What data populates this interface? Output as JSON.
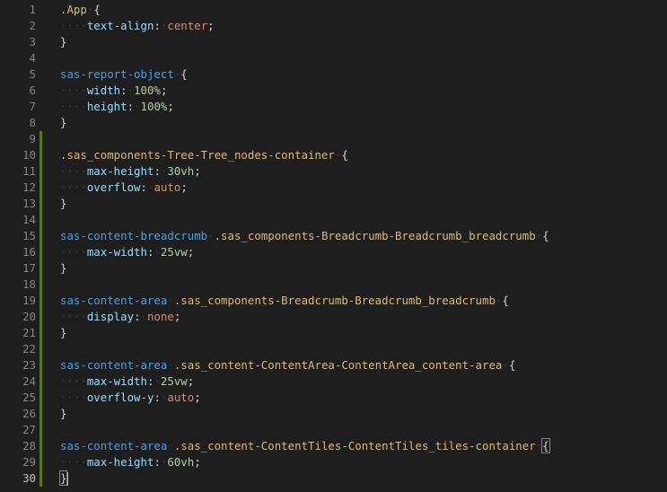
{
  "editor": {
    "language": "css",
    "cursor_line": 30,
    "lines": [
      {
        "n": "1",
        "tokens": [
          {
            "t": "sel",
            "v": ".App"
          },
          {
            "t": "sp"
          },
          {
            "t": "punc",
            "v": "{"
          }
        ]
      },
      {
        "n": "2",
        "tokens": [
          {
            "t": "ind"
          },
          {
            "t": "prop",
            "v": "text-align"
          },
          {
            "t": "punc",
            "v": ":"
          },
          {
            "t": "sp"
          },
          {
            "t": "val",
            "v": "center"
          },
          {
            "t": "punc",
            "v": ";"
          }
        ]
      },
      {
        "n": "3",
        "tokens": [
          {
            "t": "punc",
            "v": "}"
          }
        ]
      },
      {
        "n": "4",
        "tokens": []
      },
      {
        "n": "5",
        "tokens": [
          {
            "t": "tag",
            "v": "sas-report-object"
          },
          {
            "t": "sp"
          },
          {
            "t": "punc",
            "v": "{"
          }
        ]
      },
      {
        "n": "6",
        "tokens": [
          {
            "t": "ind"
          },
          {
            "t": "prop",
            "v": "width"
          },
          {
            "t": "punc",
            "v": ":"
          },
          {
            "t": "sp"
          },
          {
            "t": "num",
            "v": "100%"
          },
          {
            "t": "punc",
            "v": ";"
          }
        ]
      },
      {
        "n": "7",
        "tokens": [
          {
            "t": "ind"
          },
          {
            "t": "prop",
            "v": "height"
          },
          {
            "t": "punc",
            "v": ":"
          },
          {
            "t": "sp"
          },
          {
            "t": "num",
            "v": "100%"
          },
          {
            "t": "punc",
            "v": ";"
          }
        ]
      },
      {
        "n": "8",
        "tokens": [
          {
            "t": "punc",
            "v": "}"
          }
        ]
      },
      {
        "n": "9",
        "tokens": []
      },
      {
        "n": "10",
        "tokens": [
          {
            "t": "sel",
            "v": ".sas_components-Tree-Tree_nodes-container"
          },
          {
            "t": "sp"
          },
          {
            "t": "punc",
            "v": "{"
          }
        ]
      },
      {
        "n": "11",
        "tokens": [
          {
            "t": "ind"
          },
          {
            "t": "prop",
            "v": "max-height"
          },
          {
            "t": "punc",
            "v": ":"
          },
          {
            "t": "sp"
          },
          {
            "t": "num",
            "v": "30vh"
          },
          {
            "t": "punc",
            "v": ";"
          }
        ]
      },
      {
        "n": "12",
        "tokens": [
          {
            "t": "ind"
          },
          {
            "t": "prop",
            "v": "overflow"
          },
          {
            "t": "punc",
            "v": ":"
          },
          {
            "t": "sp"
          },
          {
            "t": "val",
            "v": "auto"
          },
          {
            "t": "punc",
            "v": ";"
          }
        ]
      },
      {
        "n": "13",
        "tokens": [
          {
            "t": "punc",
            "v": "}"
          }
        ]
      },
      {
        "n": "14",
        "tokens": []
      },
      {
        "n": "15",
        "tokens": [
          {
            "t": "tag",
            "v": "sas-content-breadcrumb"
          },
          {
            "t": "sp"
          },
          {
            "t": "sel",
            "v": ".sas_components-Breadcrumb-Breadcrumb_breadcrumb"
          },
          {
            "t": "sp"
          },
          {
            "t": "punc",
            "v": "{"
          }
        ]
      },
      {
        "n": "16",
        "tokens": [
          {
            "t": "ind"
          },
          {
            "t": "prop",
            "v": "max-width"
          },
          {
            "t": "punc",
            "v": ":"
          },
          {
            "t": "sp"
          },
          {
            "t": "num",
            "v": "25vw"
          },
          {
            "t": "punc",
            "v": ";"
          }
        ]
      },
      {
        "n": "17",
        "tokens": [
          {
            "t": "punc",
            "v": "}"
          }
        ]
      },
      {
        "n": "18",
        "tokens": []
      },
      {
        "n": "19",
        "tokens": [
          {
            "t": "tag",
            "v": "sas-content-area"
          },
          {
            "t": "sp"
          },
          {
            "t": "sel",
            "v": ".sas_components-Breadcrumb-Breadcrumb_breadcrumb"
          },
          {
            "t": "sp"
          },
          {
            "t": "punc",
            "v": "{"
          }
        ]
      },
      {
        "n": "20",
        "tokens": [
          {
            "t": "ind"
          },
          {
            "t": "prop",
            "v": "display"
          },
          {
            "t": "punc",
            "v": ":"
          },
          {
            "t": "sp"
          },
          {
            "t": "val",
            "v": "none"
          },
          {
            "t": "punc",
            "v": ";"
          }
        ]
      },
      {
        "n": "21",
        "tokens": [
          {
            "t": "punc",
            "v": "}"
          }
        ]
      },
      {
        "n": "22",
        "tokens": []
      },
      {
        "n": "23",
        "tokens": [
          {
            "t": "tag",
            "v": "sas-content-area"
          },
          {
            "t": "sp"
          },
          {
            "t": "sel",
            "v": ".sas_content-ContentArea-ContentArea_content-area"
          },
          {
            "t": "sp"
          },
          {
            "t": "punc",
            "v": "{"
          }
        ]
      },
      {
        "n": "24",
        "tokens": [
          {
            "t": "ind"
          },
          {
            "t": "prop",
            "v": "max-width"
          },
          {
            "t": "punc",
            "v": ":"
          },
          {
            "t": "sp"
          },
          {
            "t": "num",
            "v": "25vw"
          },
          {
            "t": "punc",
            "v": ";"
          }
        ]
      },
      {
        "n": "25",
        "tokens": [
          {
            "t": "ind"
          },
          {
            "t": "prop",
            "v": "overflow-y"
          },
          {
            "t": "punc",
            "v": ":"
          },
          {
            "t": "sp"
          },
          {
            "t": "val",
            "v": "auto"
          },
          {
            "t": "punc",
            "v": ";"
          }
        ]
      },
      {
        "n": "26",
        "tokens": [
          {
            "t": "punc",
            "v": "}"
          }
        ]
      },
      {
        "n": "27",
        "tokens": []
      },
      {
        "n": "28",
        "tokens": [
          {
            "t": "tag",
            "v": "sas-content-area"
          },
          {
            "t": "sp"
          },
          {
            "t": "sel",
            "v": ".sas_content-ContentTiles-ContentTiles_tiles-container"
          },
          {
            "t": "sp"
          },
          {
            "t": "bracket",
            "v": "{"
          }
        ]
      },
      {
        "n": "29",
        "tokens": [
          {
            "t": "ind"
          },
          {
            "t": "prop",
            "v": "max-height"
          },
          {
            "t": "punc",
            "v": ":"
          },
          {
            "t": "sp"
          },
          {
            "t": "num",
            "v": "60vh"
          },
          {
            "t": "punc",
            "v": ";"
          }
        ]
      },
      {
        "n": "30",
        "tokens": [
          {
            "t": "bracket",
            "v": "}"
          },
          {
            "t": "cursor"
          }
        ]
      }
    ],
    "modified_lines": [
      "9",
      "10",
      "11",
      "12",
      "13",
      "14",
      "15",
      "16",
      "17",
      "18",
      "19",
      "20",
      "21",
      "22",
      "23",
      "24",
      "25",
      "26",
      "27",
      "28",
      "29",
      "30"
    ],
    "colors": {
      "background": "#1e1e1e",
      "line_number": "#858585",
      "line_number_active": "#c6c6c6",
      "selector": "#d7ba7d",
      "tag": "#569cd6",
      "property": "#9cdcfe",
      "string_value": "#ce9178",
      "number_value": "#b5cea8",
      "punctuation": "#d4d4d4",
      "git_modified": "#587c0c",
      "whitespace": "#404040"
    }
  }
}
